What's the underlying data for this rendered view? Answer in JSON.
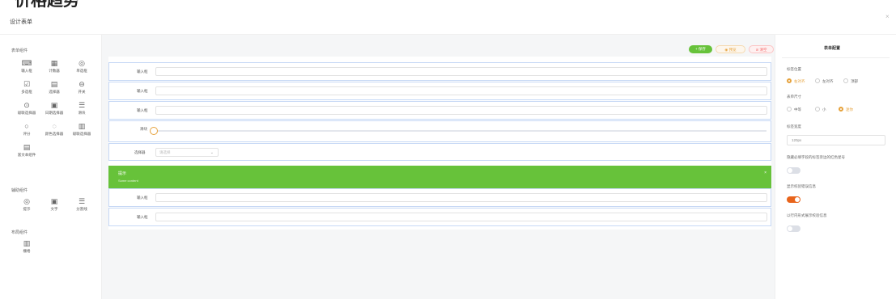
{
  "page": {
    "heading": "价格趋势",
    "dialog_title": "设计表单",
    "close": "×"
  },
  "palette": {
    "sidebar_title": "表单组件",
    "components": [
      {
        "icon": "text-input-icon",
        "glyph": "⌨",
        "label": "输入框"
      },
      {
        "icon": "number-input-icon",
        "glyph": "▦",
        "label": "计数器"
      },
      {
        "icon": "radio-icon",
        "glyph": "◎",
        "label": "单选框"
      },
      {
        "icon": "checkbox-icon",
        "glyph": "☑",
        "label": "多选框"
      },
      {
        "icon": "select-icon",
        "glyph": "▤",
        "label": "选择器"
      },
      {
        "icon": "switch-icon",
        "glyph": "⊖",
        "label": "开关"
      },
      {
        "icon": "cascader-icon",
        "glyph": "⊙",
        "label": "级联选择器"
      },
      {
        "icon": "date-icon",
        "glyph": "▣",
        "label": "日期选择器"
      },
      {
        "icon": "rate-icon",
        "glyph": "☰",
        "label": "滑块"
      },
      {
        "icon": "time-icon",
        "glyph": "○",
        "label": "评分"
      },
      {
        "icon": "color-icon",
        "glyph": "◌",
        "label": "颜色选择器"
      },
      {
        "icon": "upload-icon",
        "glyph": "▥",
        "label": "级联选择器"
      },
      {
        "icon": "editor-icon",
        "glyph": "▤",
        "label": "富文本组件"
      }
    ],
    "aux_title": "辅助组件",
    "aux": [
      {
        "icon": "alert-icon",
        "glyph": "◎",
        "label": "提示"
      },
      {
        "icon": "text-icon",
        "glyph": "▣",
        "label": "文字"
      },
      {
        "icon": "divider-icon",
        "glyph": "☰",
        "label": "分割线"
      }
    ],
    "layout_title": "布局组件",
    "layout": [
      {
        "icon": "grid-icon",
        "glyph": "▥",
        "label": "栅格"
      }
    ]
  },
  "toolbar": {
    "save": "+ 保存",
    "preview": "◉ 预览 ",
    "clear": "⊘ 清空 "
  },
  "form": {
    "rows": [
      {
        "label": "输入框"
      },
      {
        "label": "输入框"
      },
      {
        "label": "输入框"
      }
    ],
    "slider_label": "滑块",
    "slider_value": 0,
    "select_label": "选择器",
    "select_placeholder": "请选择",
    "alert_title": "提示",
    "alert_desc": "Some content",
    "rows_after": [
      {
        "label": "输入框"
      },
      {
        "label": "输入框"
      }
    ]
  },
  "config": {
    "title": "表单配置",
    "label_position": "标签位置",
    "label_position_options": [
      "右对齐",
      "左对齐",
      "顶部"
    ],
    "label_position_selected": 0,
    "size": "表单尺寸",
    "size_options": [
      "中等",
      "小",
      "迷你"
    ],
    "size_selected": 2,
    "label_width": "标签宽度",
    "label_width_value": "120px",
    "required_asterisk": "隐藏必填字段的标签旁边的红色星号",
    "required_asterisk_on": false,
    "show_message": "显示校验错误信息",
    "show_message_on": true,
    "inline_message": "以行内形式展示校验信息",
    "inline_message_on": false
  }
}
